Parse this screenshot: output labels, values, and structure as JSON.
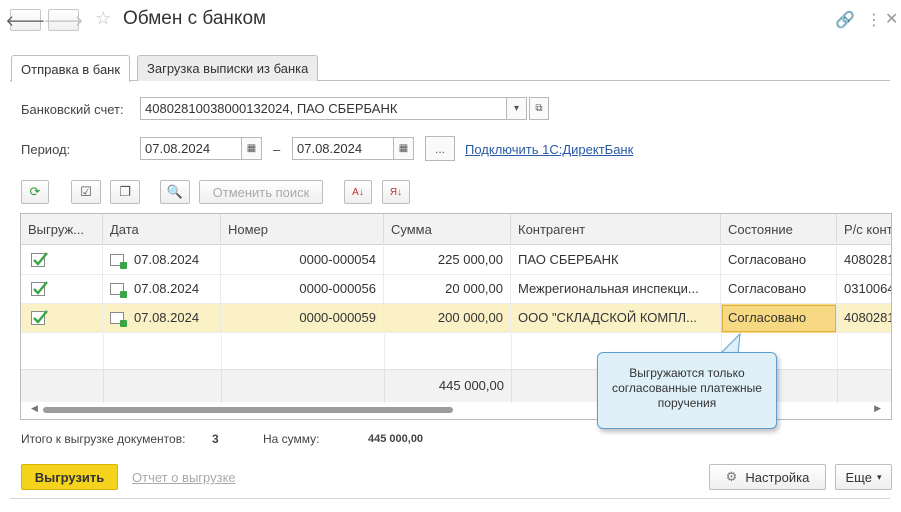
{
  "window": {
    "title": "Обмен с банком"
  },
  "tabs": [
    {
      "label": "Отправка в банк",
      "active": true
    },
    {
      "label": "Загрузка выписки из банка",
      "active": false
    }
  ],
  "form": {
    "account_label": "Банковский счет:",
    "account_value": "40802810038000132024, ПАО СБЕРБАНК",
    "period_label": "Период:",
    "period_from": "07.08.2024",
    "period_dash": "–",
    "period_to": "07.08.2024",
    "period_more": "...",
    "connect_link": "Подключить 1С:ДиректБанк"
  },
  "toolbar": {
    "cancel_search": "Отменить поиск"
  },
  "table": {
    "columns": [
      "Выгруж...",
      "Дата",
      "Номер",
      "Сумма",
      "Контрагент",
      "Состояние",
      "Р/с конт"
    ],
    "rows": [
      {
        "date": "07.08.2024",
        "number": "0000-000054",
        "sum": "225 000,00",
        "counterparty": "ПАО СБЕРБАНК",
        "state": "Согласовано",
        "account": "4080281"
      },
      {
        "date": "07.08.2024",
        "number": "0000-000056",
        "sum": "20 000,00",
        "counterparty": "Межрегиональная инспекци...",
        "state": "Согласовано",
        "account": "0310064"
      },
      {
        "date": "07.08.2024",
        "number": "0000-000059",
        "sum": "200 000,00",
        "counterparty": "ООО \"СКЛАДСКОЙ КОМПЛ...",
        "state": "Согласовано",
        "account": "4080281"
      }
    ],
    "total": "445 000,00"
  },
  "summary": {
    "docs_label": "Итого к выгрузке документов:",
    "docs_count": "3",
    "sum_label": "На сумму:",
    "sum_value": "445 000,00"
  },
  "buttons": {
    "export": "Выгрузить",
    "report": "Отчет о выгрузке",
    "settings": "Настройка",
    "more": "Еще"
  },
  "callout": {
    "text": "Выгружаются только согласованные платежные поручения"
  },
  "colors": {
    "primary": "#f5d31d",
    "selected_row": "#fbf1c7",
    "link": "#2a5aa6",
    "check": "#3aa545"
  }
}
